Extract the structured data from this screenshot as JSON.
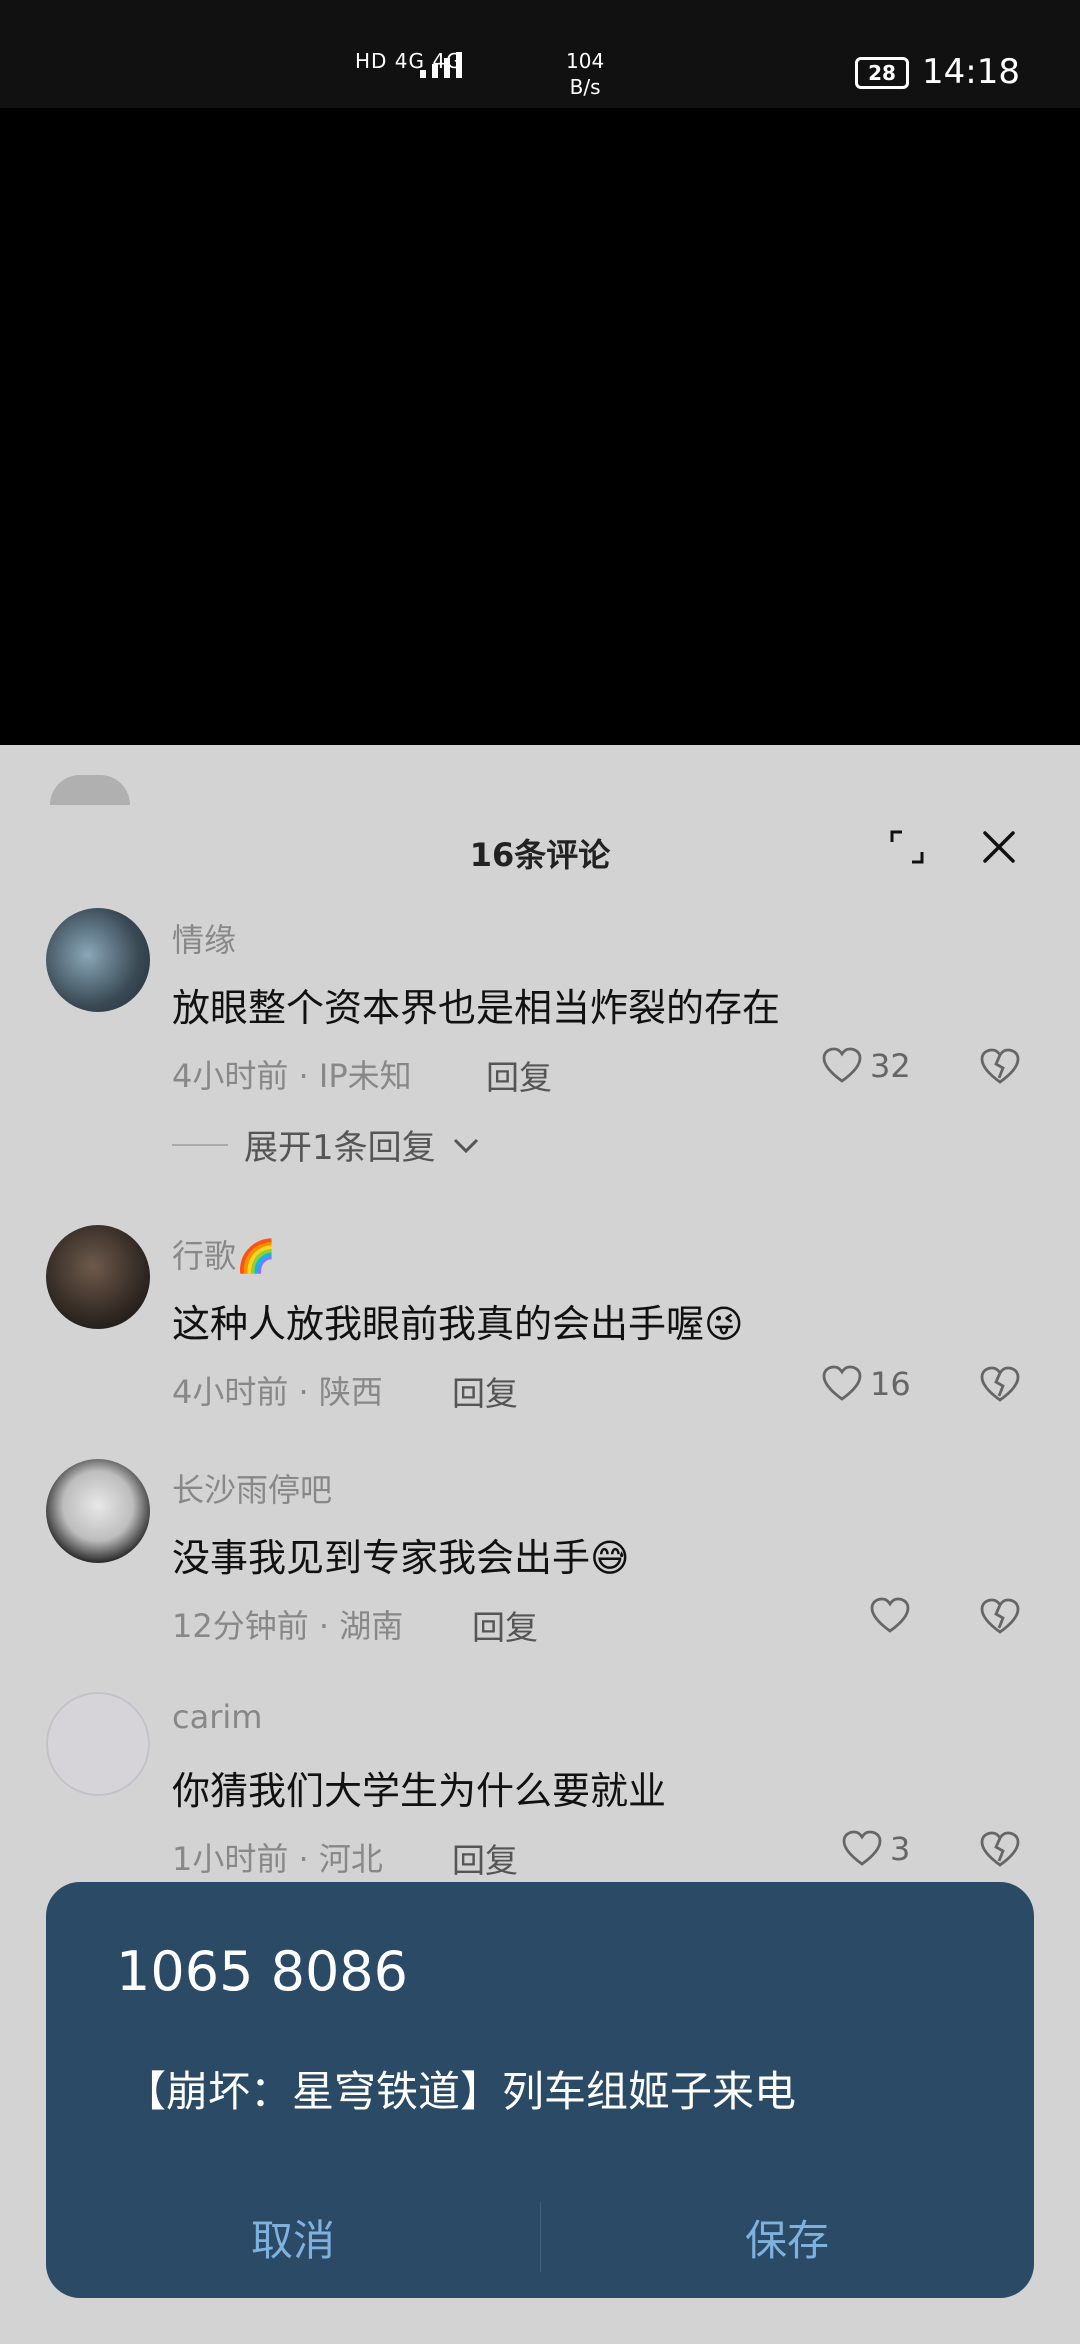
{
  "status_bar": {
    "network": "HD 4G 4G",
    "speed_value": "104",
    "speed_unit": "B/s",
    "battery": "28",
    "time": "14:18"
  },
  "sheet": {
    "title": "16条评论"
  },
  "comments": [
    {
      "user": "情缘",
      "text": "放眼整个资本界也是相当炸裂的存在",
      "meta": "4小时前 · IP未知",
      "reply": "回复",
      "likes": "32"
    },
    {
      "user": "行歌🌈",
      "text": "这种人放我眼前我真的会出手喔😜",
      "meta": "4小时前 · 陕西",
      "reply": "回复",
      "likes": "16"
    },
    {
      "user": "长沙雨停吧",
      "text": "没事我见到专家我会出手😅",
      "meta": "12分钟前 · 湖南",
      "reply": "回复",
      "likes": ""
    },
    {
      "user": "carim",
      "text": "你猜我们大学生为什么要就业",
      "meta": "1小时前 · 河北",
      "reply": "回复",
      "likes": "3"
    }
  ],
  "expand_replies": "展开1条回复",
  "dialog": {
    "sender": "1065 8086",
    "body": "【崩坏：星穹铁道】列车组姬子来电",
    "cancel": "取消",
    "save": "保存"
  }
}
